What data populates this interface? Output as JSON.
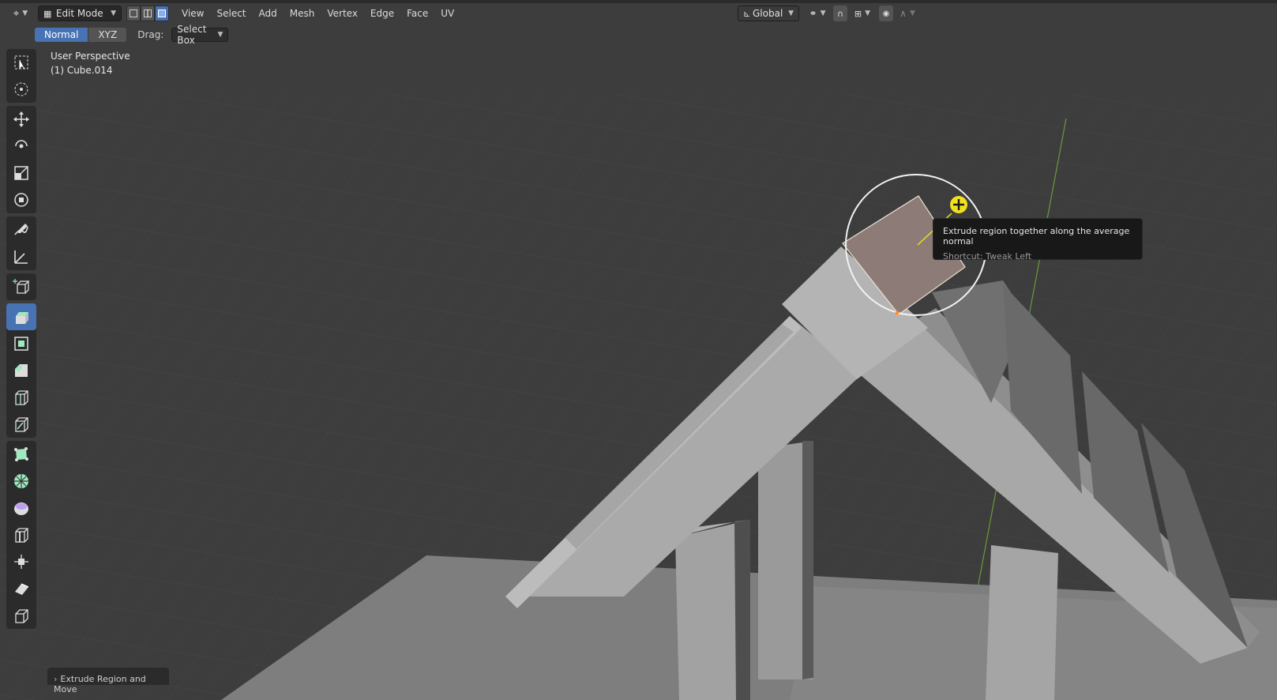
{
  "header": {
    "editor_type_icon": "editor-type-icon",
    "mode": "Edit Mode",
    "select_modes": [
      "vertex-select-icon",
      "edge-select-icon",
      "face-select-icon"
    ],
    "menus": [
      "View",
      "Select",
      "Add",
      "Mesh",
      "Vertex",
      "Edge",
      "Face",
      "UV"
    ],
    "orientation": "Global",
    "pivot_icon": "pivot-icon",
    "snap_icon": "snap-icon",
    "proportional_icon": "proportional-edit-icon",
    "falloff_icon": "falloff-icon"
  },
  "tool_settings": {
    "orient_options": [
      "Normal",
      "XYZ"
    ],
    "orient_selected": "Normal",
    "drag_label": "Drag:",
    "drag_value": "Select Box"
  },
  "viewport": {
    "view_name": "User Perspective",
    "object_name": "(1) Cube.014"
  },
  "tooltip": {
    "title": "Extrude region together along the average normal",
    "shortcut": "Shortcut: Tweak Left"
  },
  "last_operator": "Extrude Region and Move",
  "toolbar_icons": [
    "select-box-icon",
    "cursor-icon",
    "move-icon",
    "rotate-icon",
    "scale-icon",
    "transform-icon",
    "annotate-icon",
    "measure-icon",
    "add-cube-icon",
    "extrude-region-icon",
    "inset-faces-icon",
    "bevel-icon",
    "loop-cut-icon",
    "knife-icon",
    "poly-build-icon",
    "spin-icon",
    "smooth-icon",
    "edge-slide-icon",
    "shrink-fatten-icon",
    "shear-icon",
    "rip-region-icon"
  ],
  "colors": {
    "accent": "#4772b3",
    "selected_face": "#8c7b76",
    "gizmo": "#f0e020",
    "background": "#3d3d3d"
  }
}
